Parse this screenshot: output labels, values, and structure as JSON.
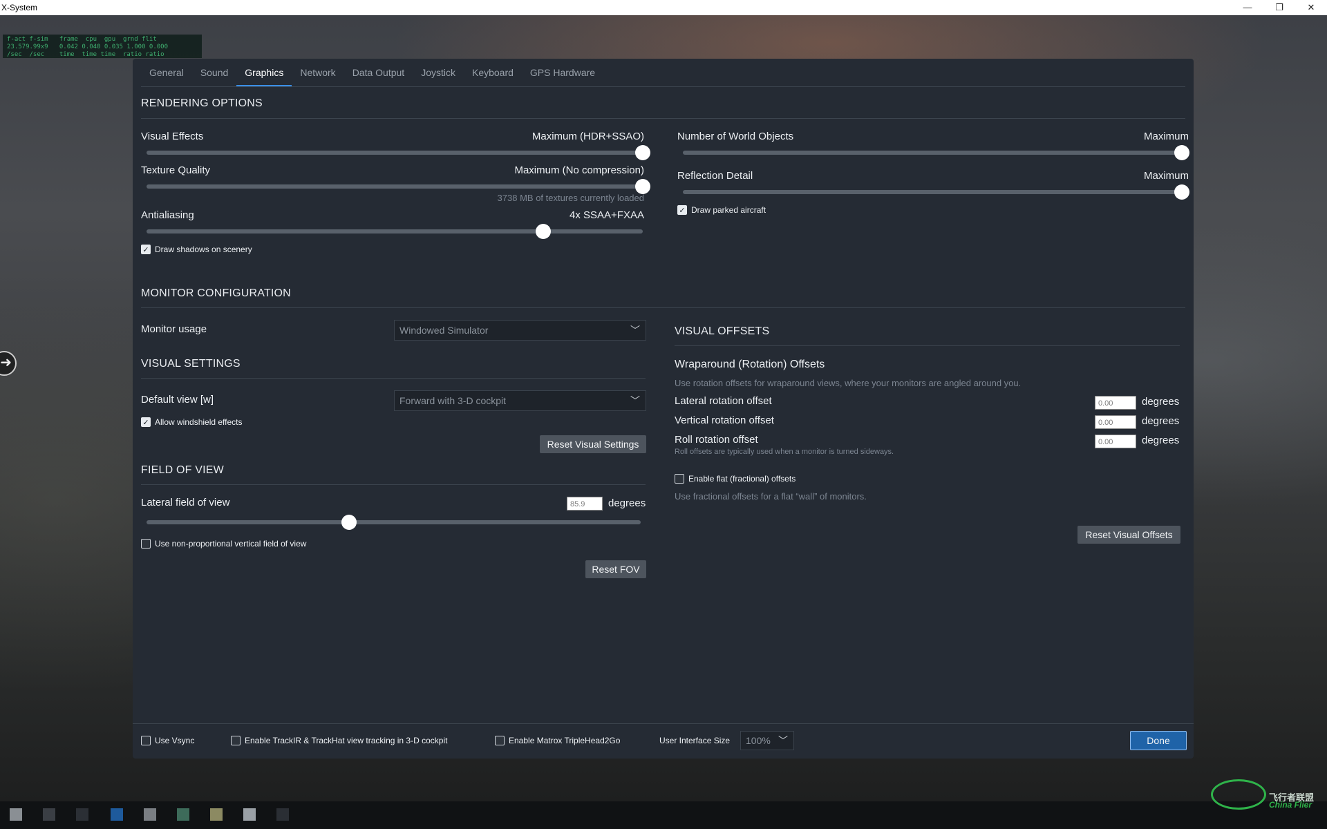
{
  "window": {
    "title": "X-System",
    "controls": {
      "minimize": "—",
      "restore": "❐",
      "close": "✕"
    }
  },
  "stats_overlay": {
    "text": "f-act f-sim   frame  cpu  gpu  grnd flit\n23.579.99x9   0.042 0.040 0.035 1.000 0.000\n/sec  /sec    time  time time  ratio ratio"
  },
  "tabs": [
    {
      "label": "General"
    },
    {
      "label": "Sound"
    },
    {
      "label": "Graphics",
      "active": true
    },
    {
      "label": "Network"
    },
    {
      "label": "Data Output"
    },
    {
      "label": "Joystick"
    },
    {
      "label": "Keyboard"
    },
    {
      "label": "GPS Hardware"
    }
  ],
  "rendering": {
    "title": "RENDERING OPTIONS",
    "visual_effects": {
      "label": "Visual Effects",
      "value": "Maximum (HDR+SSAO)",
      "level": 1.0
    },
    "texture_quality": {
      "label": "Texture Quality",
      "value": "Maximum (No compression)",
      "level": 1.0,
      "hint": "3738 MB of textures currently loaded"
    },
    "antialiasing": {
      "label": "Antialiasing",
      "value": "4x SSAA+FXAA",
      "level": 0.8
    },
    "draw_shadows": {
      "label": "Draw shadows on scenery",
      "checked": true
    },
    "world_objects": {
      "label": "Number of World Objects",
      "value": "Maximum",
      "level": 1.0
    },
    "reflection_detail": {
      "label": "Reflection Detail",
      "value": "Maximum",
      "level": 1.0
    },
    "draw_parked": {
      "label": "Draw parked aircraft",
      "checked": true
    }
  },
  "monitor": {
    "title": "MONITOR CONFIGURATION",
    "usage_label": "Monitor usage",
    "usage_value": "Windowed Simulator"
  },
  "visual_settings": {
    "title": "VISUAL SETTINGS",
    "default_view_label": "Default view [w]",
    "default_view_value": "Forward with 3-D cockpit",
    "windshield": {
      "label": "Allow windshield effects",
      "checked": true
    },
    "reset_label": "Reset Visual Settings"
  },
  "fov": {
    "title": "FIELD OF VIEW",
    "lateral_label": "Lateral field of view",
    "lateral_value": "85.9",
    "unit": "degrees",
    "level": 0.41,
    "non_proportional": {
      "label": "Use non-proportional vertical field of view",
      "checked": false
    },
    "reset_label": "Reset FOV"
  },
  "visual_offsets": {
    "title": "VISUAL OFFSETS",
    "wrap_title": "Wraparound (Rotation) Offsets",
    "wrap_hint": "Use rotation offsets for wraparound views, where your monitors are angled around you.",
    "lateral": {
      "label": "Lateral rotation offset",
      "value": "0.00",
      "unit": "degrees"
    },
    "vertical": {
      "label": "Vertical rotation offset",
      "value": "0.00",
      "unit": "degrees"
    },
    "roll": {
      "label": "Roll rotation offset",
      "value": "0.00",
      "unit": "degrees",
      "hint": "Roll offsets are typically used when a monitor is turned sideways."
    },
    "flat": {
      "label": "Enable flat (fractional) offsets",
      "checked": false
    },
    "flat_hint": "Use fractional offsets for a flat “wall” of monitors.",
    "reset_label": "Reset Visual Offsets"
  },
  "footer": {
    "vsync": {
      "label": "Use Vsync",
      "checked": false
    },
    "trackir": {
      "label": "Enable TrackIR & TrackHat view tracking in 3-D cockpit",
      "checked": false
    },
    "matrox": {
      "label": "Enable Matrox TripleHead2Go",
      "checked": false
    },
    "ui_size_label": "User Interface Size",
    "ui_size_value": "100%",
    "done_label": "Done"
  },
  "watermark": {
    "cn": "飞行者联盟",
    "en": "China Flier"
  },
  "colors": {
    "accent": "#3a8ee6",
    "panel": "#252b34",
    "primary_button": "#1f63a8"
  },
  "icons": {
    "checkmark": "✓",
    "chevron": "﹀",
    "arrow": "➜"
  }
}
